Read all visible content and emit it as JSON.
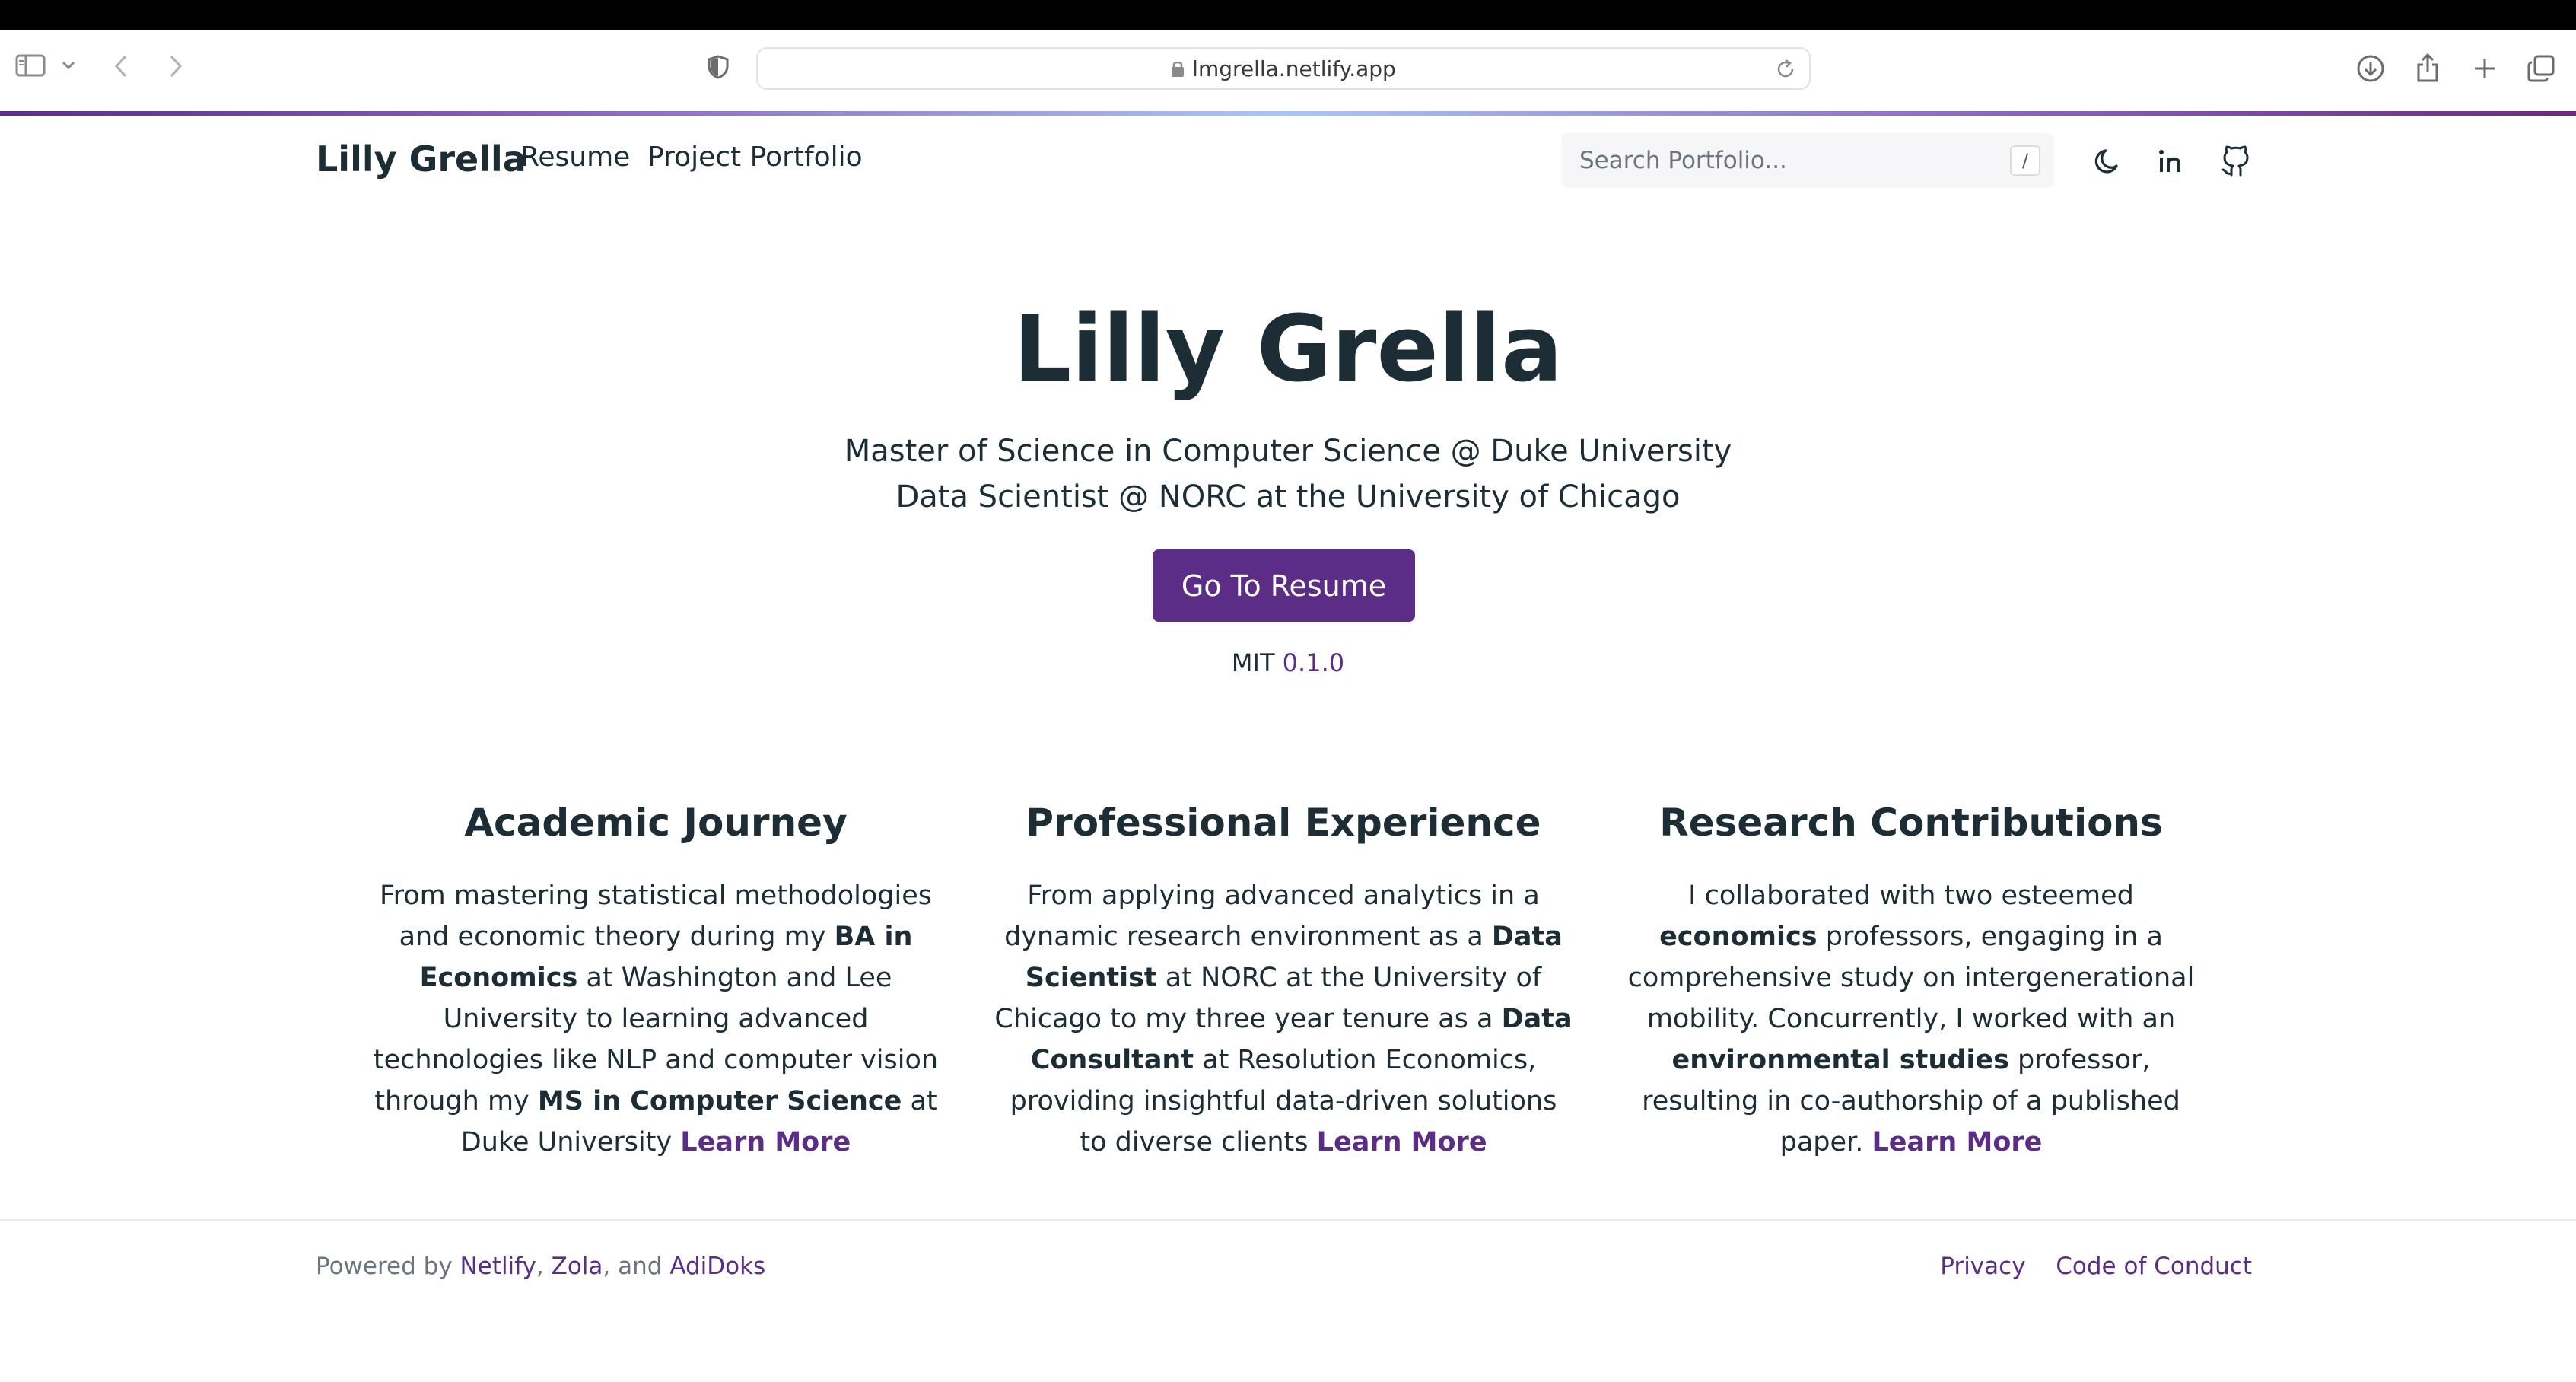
{
  "browser": {
    "url": "lmgrella.netlify.app"
  },
  "nav": {
    "brand": "Lilly Grella",
    "links": [
      "Resume",
      "Project Portfolio"
    ],
    "search_placeholder": "Search Portfolio...",
    "search_shortcut": "/"
  },
  "hero": {
    "title": "Lilly Grella",
    "line1": "Master of Science in Computer Science @ Duke University",
    "line2": "Data Scientist @ NORC at the University of Chicago",
    "button": "Go To Resume",
    "license": "MIT",
    "version": "0.1.0"
  },
  "features": {
    "academic": {
      "title": "Academic Journey",
      "t1": "From mastering statistical methodologies and economic theory during my ",
      "b1": "BA in Economics",
      "t2": " at Washington and Lee University to learning advanced technologies like NLP and computer vision through my ",
      "b2": "MS in Computer Science",
      "t3": " at Duke University ",
      "link": "Learn More"
    },
    "professional": {
      "title": "Professional Experience",
      "t1": "From applying advanced analytics in a dynamic research environment as a ",
      "b1": "Data Scientist",
      "t2": " at NORC at the University of Chicago to my three year tenure as a ",
      "b2": "Data Consultant",
      "t3": " at Resolution Economics, providing insightful data-driven solutions to diverse clients ",
      "link": "Learn More"
    },
    "research": {
      "title": "Research Contributions",
      "t1": "I collaborated with two esteemed ",
      "b1": "economics",
      "t2": " professors, engaging in a comprehensive study on intergenerational mobility. Concurrently, I worked with an ",
      "b2": "environmental studies",
      "t3": " professor, resulting in co-authorship of a published paper. ",
      "link": "Learn More"
    }
  },
  "footer": {
    "powered_by": "Powered by ",
    "netlify": "Netlify",
    "sep1": ", ",
    "zola": "Zola",
    "sep2": ", and ",
    "adidoks": "AdiDoks",
    "privacy": "Privacy",
    "conduct": "Code of Conduct"
  },
  "colors": {
    "accent": "#5b2d86",
    "text": "#1d2d35",
    "muted": "#6c757d"
  },
  "icons": [
    "sidebar-icon",
    "chevron-down-icon",
    "back-icon",
    "forward-icon",
    "shield-icon",
    "lock-icon",
    "reload-icon",
    "download-icon",
    "share-icon",
    "new-tab-icon",
    "tabs-icon",
    "moon-icon",
    "linkedin-icon",
    "github-icon"
  ]
}
